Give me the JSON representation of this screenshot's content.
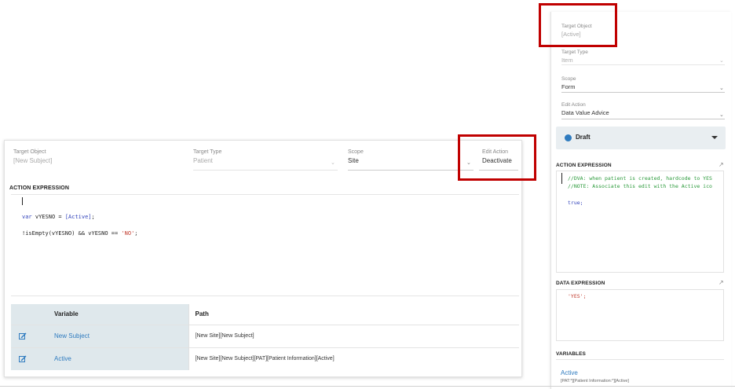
{
  "left_editor": {
    "target_object": {
      "label": "Target Object",
      "value": "[New Subject]"
    },
    "target_type": {
      "label": "Target Type",
      "value": "Patient"
    },
    "scope": {
      "label": "Scope",
      "value": "Site"
    },
    "edit_action": {
      "label": "Edit Action",
      "value": "Deactivate"
    },
    "action_expression_title": "ACTION EXPRESSION",
    "code": {
      "line1_kw": "var",
      "line1_rest": " vYESNO = ",
      "line1_id": "[Active]",
      "line1_end": ";",
      "line2_plain": "!isEmpty(vYESNO) && vYESNO == ",
      "line2_str": "'NO'",
      "line2_end": ";"
    },
    "variables_table": {
      "columns": [
        "Variable",
        "Path"
      ],
      "rows": [
        {
          "variable": "New Subject",
          "path": "[New Site][New Subject]"
        },
        {
          "variable": "Active",
          "path": "[New Site][New Subject][PAT][Patient Information][Active]"
        }
      ]
    }
  },
  "right_panel": {
    "target_object": {
      "label": "Target Object",
      "value": "[Active]"
    },
    "target_type": {
      "label": "Target Type",
      "value": "Item"
    },
    "scope": {
      "label": "Scope",
      "value": "Form"
    },
    "edit_action": {
      "label": "Edit Action",
      "value": "Data Value Advice"
    },
    "status": "Draft",
    "action_expression_title": "ACTION EXPRESSION",
    "action_code": {
      "comment1": "//DVA: when patient is created, hardcode to YES",
      "comment2": "//NOTE: Associate this edit with the Active ico",
      "line3": "true;"
    },
    "data_expression_title": "DATA EXPRESSION",
    "data_code": "'YES';",
    "variables_title": "VARIABLES",
    "variable_name": "Active",
    "variable_path": "[PAT:*][Patient Information:*][Active]"
  },
  "colors": {
    "highlight": "#c00000",
    "link": "#2f7bbf",
    "table_variable_bg": "#dfe8ec",
    "draft_bg": "#e9eef1"
  }
}
